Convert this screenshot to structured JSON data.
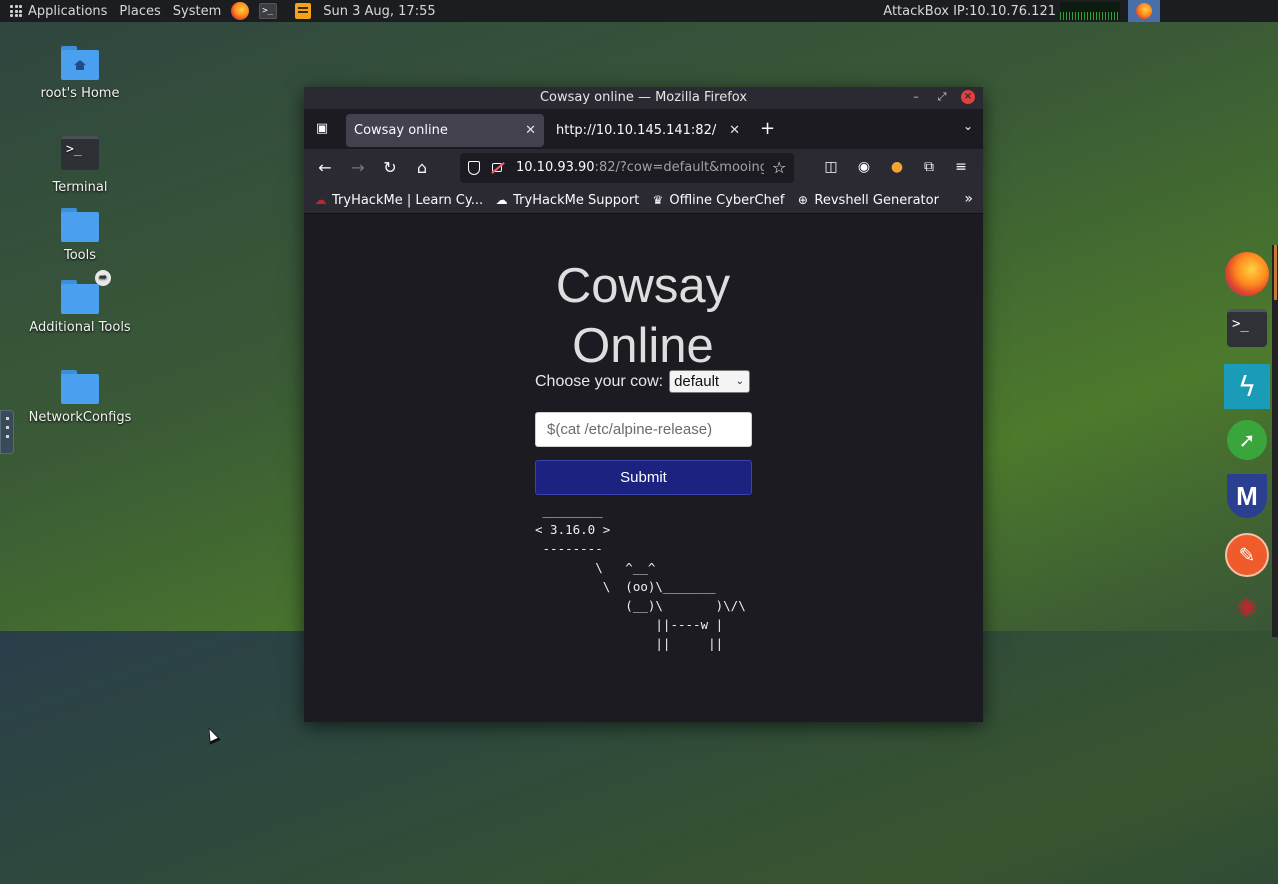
{
  "top_panel": {
    "applications": "Applications",
    "places": "Places",
    "system": "System",
    "datetime": "Sun 3 Aug, 17:55",
    "attackbox_ip": "AttackBox IP:10.10.76.121"
  },
  "desktop": {
    "icons": [
      {
        "label": "root's Home"
      },
      {
        "label": "Terminal"
      },
      {
        "label": "Tools"
      },
      {
        "label": "Additional Tools"
      },
      {
        "label": "NetworkConfigs"
      }
    ]
  },
  "window": {
    "title": "Cowsay online — Mozilla Firefox",
    "tabs": [
      {
        "label": "Cowsay online",
        "active": true
      },
      {
        "label": "http://10.10.145.141:82/",
        "active": false
      }
    ],
    "url_host": "10.10.93.90",
    "url_rest": ":82/?cow=default&mooing=",
    "bookmarks": [
      {
        "label": "TryHackMe | Learn Cy..."
      },
      {
        "label": "TryHackMe Support"
      },
      {
        "label": "Offline CyberChef"
      },
      {
        "label": "Revshell Generator"
      }
    ]
  },
  "page": {
    "title_line1": "Cowsay",
    "title_line2": "Online",
    "choose_label": "Choose your cow:",
    "cow_selected": "default",
    "input_value": "$(cat /etc/alpine-release)",
    "submit_label": "Submit",
    "output": " ________\n< 3.16.0 >\n --------\n        \\   ^__^\n         \\  (oo)\\_______\n            (__)\\       )\\/\\\n                ||----w |\n                ||     ||"
  },
  "colors": {
    "submit_bg": "#1b2280",
    "browser_bg": "#1c1b22",
    "close_button": "#e0403e"
  }
}
